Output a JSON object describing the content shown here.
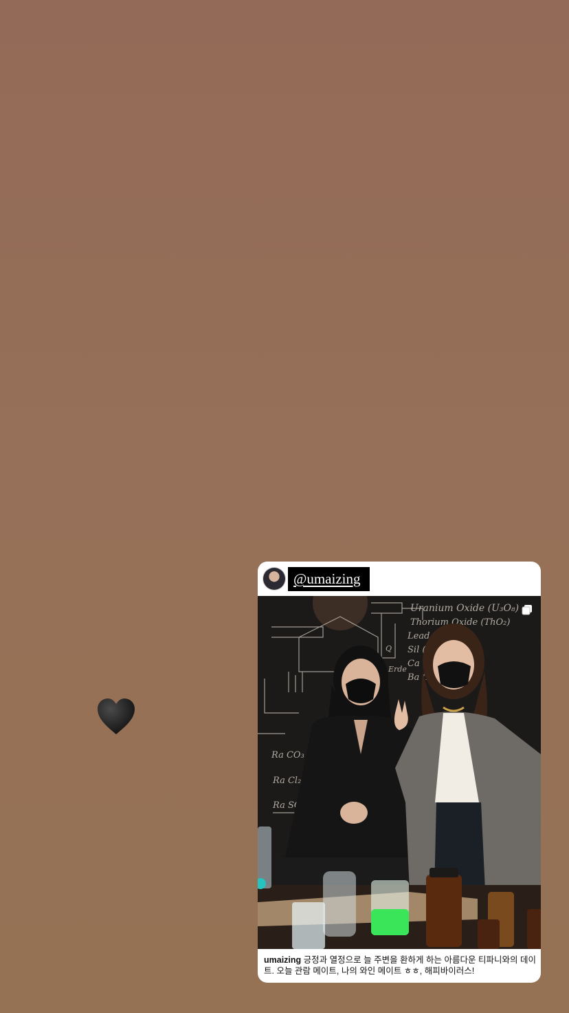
{
  "story": {
    "sticker": {
      "icon": "black-heart-icon"
    },
    "shared_post": {
      "mention": "@umaizing",
      "username": "umaizing",
      "caption": "긍정과 열정으로 늘 주변을 환하게 하는 아름다운 티파니와의 데이트. 오늘 관람 메이트, 나의 와인 메이트 ㅎㅎ, 해피바이러스!",
      "photo_chalk_text": [
        "Uranium Oxide (U₃O₈)",
        "Thorium Oxide (ThO₂)",
        "Lead (PbS)",
        "Sil (SiO₂)",
        "Ca (CaO)",
        "Ba (BaO)",
        "Erde",
        "Ra CO₃",
        "Ra Cl₂",
        "Ra SO₄",
        "Q"
      ],
      "multi_photo_icon": "multiple-photos-icon"
    }
  },
  "colors": {
    "background": "#947057",
    "card": "#ffffff",
    "tag_bg": "#000000"
  }
}
